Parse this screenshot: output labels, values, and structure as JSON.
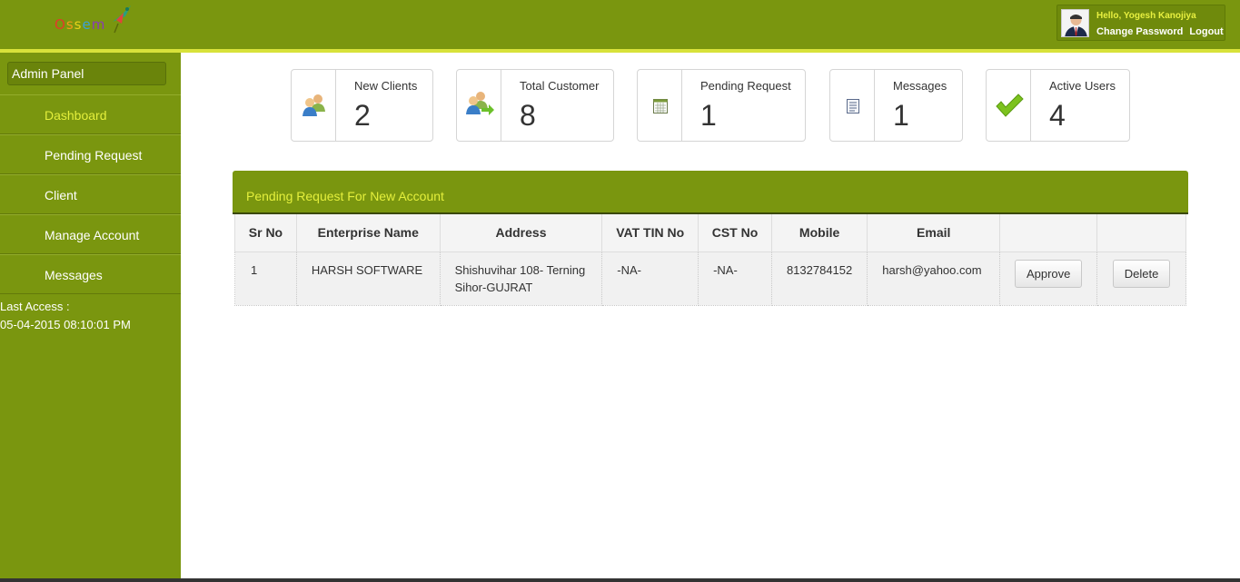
{
  "header": {
    "logo_text": "Ossem",
    "greeting": "Hello, Yogesh Kanojiya",
    "change_password": "Change Password",
    "logout": "Logout"
  },
  "sidebar": {
    "title": "Admin Panel",
    "items": [
      {
        "label": "Dashboard",
        "active": true
      },
      {
        "label": "Pending Request"
      },
      {
        "label": "Client"
      },
      {
        "label": "Manage Account"
      },
      {
        "label": "Messages"
      }
    ],
    "last_access_label": "Last Access :",
    "last_access_value": "05-04-2015 08:10:01 PM"
  },
  "stats": [
    {
      "label": "New Clients",
      "value": "2",
      "icon": "users-icon"
    },
    {
      "label": "Total Customer",
      "value": "8",
      "icon": "users-arrow-icon"
    },
    {
      "label": "Pending Request",
      "value": "1",
      "icon": "calendar-icon"
    },
    {
      "label": "Messages",
      "value": "1",
      "icon": "document-icon"
    },
    {
      "label": "Active Users",
      "value": "4",
      "icon": "check-icon"
    }
  ],
  "panel": {
    "title": "Pending Request For New Account",
    "columns": [
      "Sr No",
      "Enterprise Name",
      "Address",
      "VAT TIN No",
      "CST No",
      "Mobile",
      "Email",
      "",
      ""
    ],
    "rows": [
      {
        "sr": "1",
        "enterprise": "HARSH SOFTWARE",
        "address_line1": "Shishuvihar 108- Terning",
        "address_line2": "Sihor-GUJRAT",
        "vat": "-NA-",
        "cst": "-NA-",
        "mobile": "8132784152",
        "email": "harsh@yahoo.com",
        "approve": "Approve",
        "delete": "Delete"
      }
    ]
  },
  "colors": {
    "primary_green": "#7a960f",
    "accent_yellow": "#e4ef3c"
  }
}
